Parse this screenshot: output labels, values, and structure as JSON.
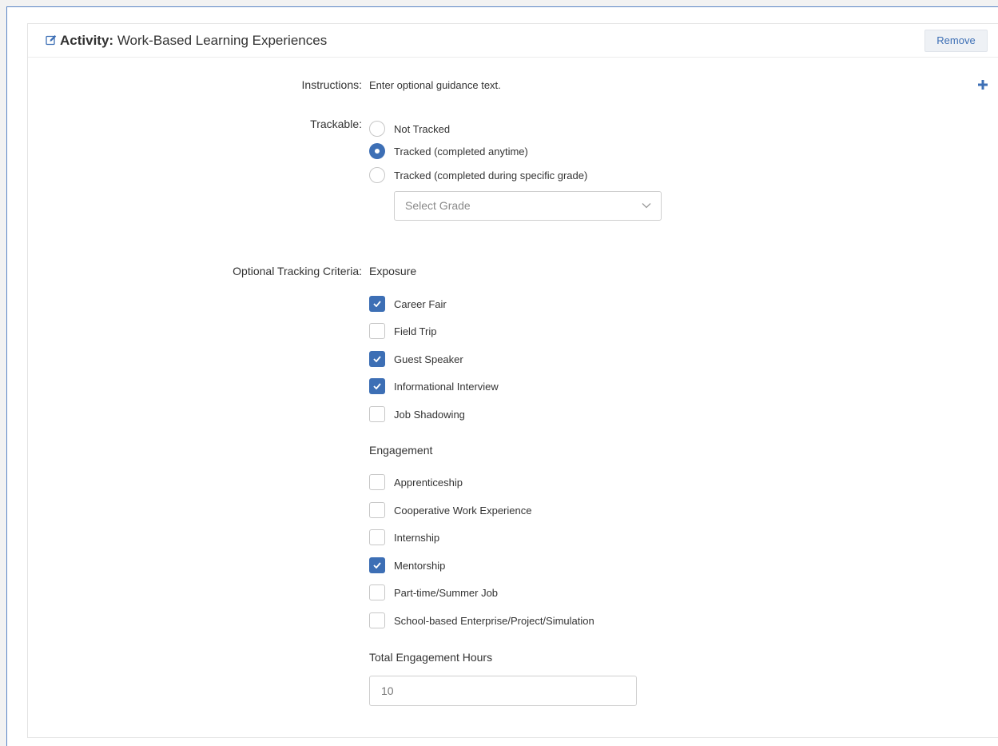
{
  "header": {
    "prefix": "Activity:",
    "title": "Work-Based Learning Experiences",
    "remove_label": "Remove",
    "edit_icon": "edit-icon"
  },
  "instructions": {
    "label": "Instructions:",
    "text": "Enter optional guidance text.",
    "add_icon": "plus-icon"
  },
  "trackable": {
    "label": "Trackable:",
    "options": [
      {
        "label": "Not Tracked",
        "selected": false
      },
      {
        "label": "Tracked (completed anytime)",
        "selected": true
      },
      {
        "label": "Tracked (completed during specific grade)",
        "selected": false
      }
    ],
    "grade_select_placeholder": "Select Grade"
  },
  "criteria": {
    "label": "Optional Tracking Criteria:",
    "exposure": {
      "heading": "Exposure",
      "items": [
        {
          "label": "Career Fair",
          "checked": true
        },
        {
          "label": "Field Trip",
          "checked": false
        },
        {
          "label": "Guest Speaker",
          "checked": true
        },
        {
          "label": "Informational Interview",
          "checked": true
        },
        {
          "label": "Job Shadowing",
          "checked": false
        }
      ]
    },
    "engagement": {
      "heading": "Engagement",
      "items": [
        {
          "label": "Apprenticeship",
          "checked": false
        },
        {
          "label": "Cooperative Work Experience",
          "checked": false
        },
        {
          "label": "Internship",
          "checked": false
        },
        {
          "label": "Mentorship",
          "checked": true
        },
        {
          "label": "Part-time/Summer Job",
          "checked": false
        },
        {
          "label": "School-based Enterprise/Project/Simulation",
          "checked": false
        }
      ]
    },
    "hours": {
      "label": "Total Engagement Hours",
      "value": "10"
    }
  },
  "colors": {
    "accent": "#3d6fb5",
    "frame_border": "#5b86c6"
  }
}
